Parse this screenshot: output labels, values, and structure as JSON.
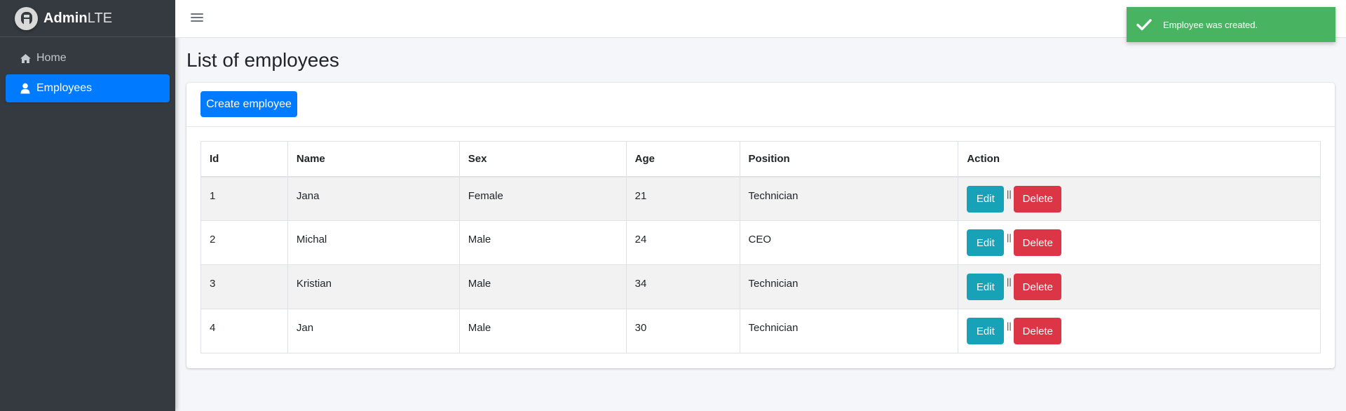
{
  "brand": {
    "bold": "Admin",
    "light": "LTE",
    "logo_icon": "adminlte-logo-icon"
  },
  "sidebar": {
    "items": [
      {
        "label": "Home",
        "icon": "home-icon",
        "active": false
      },
      {
        "label": "Employees",
        "icon": "user-icon",
        "active": true
      }
    ]
  },
  "topbar": {
    "menu_icon": "hamburger-icon"
  },
  "page": {
    "title": "List of employees"
  },
  "toolbar": {
    "create_label": "Create employee"
  },
  "table": {
    "headers": [
      "Id",
      "Name",
      "Sex",
      "Age",
      "Position",
      "Action"
    ],
    "rows": [
      {
        "id": "1",
        "name": "Jana",
        "sex": "Female",
        "age": "21",
        "position": "Technician"
      },
      {
        "id": "2",
        "name": "Michal",
        "sex": "Male",
        "age": "24",
        "position": "CEO"
      },
      {
        "id": "3",
        "name": "Kristian",
        "sex": "Male",
        "age": "34",
        "position": "Technician"
      },
      {
        "id": "4",
        "name": "Jan",
        "sex": "Male",
        "age": "30",
        "position": "Technician"
      }
    ],
    "edit_label": "Edit",
    "delete_label": "Delete",
    "separator": "||"
  },
  "toast": {
    "message": "Employee was created.",
    "icon": "checkmark-icon"
  },
  "colors": {
    "primary": "#007bff",
    "info": "#17a2b8",
    "danger": "#dc3545",
    "success": "#48b461",
    "sidebar": "#343a40"
  }
}
